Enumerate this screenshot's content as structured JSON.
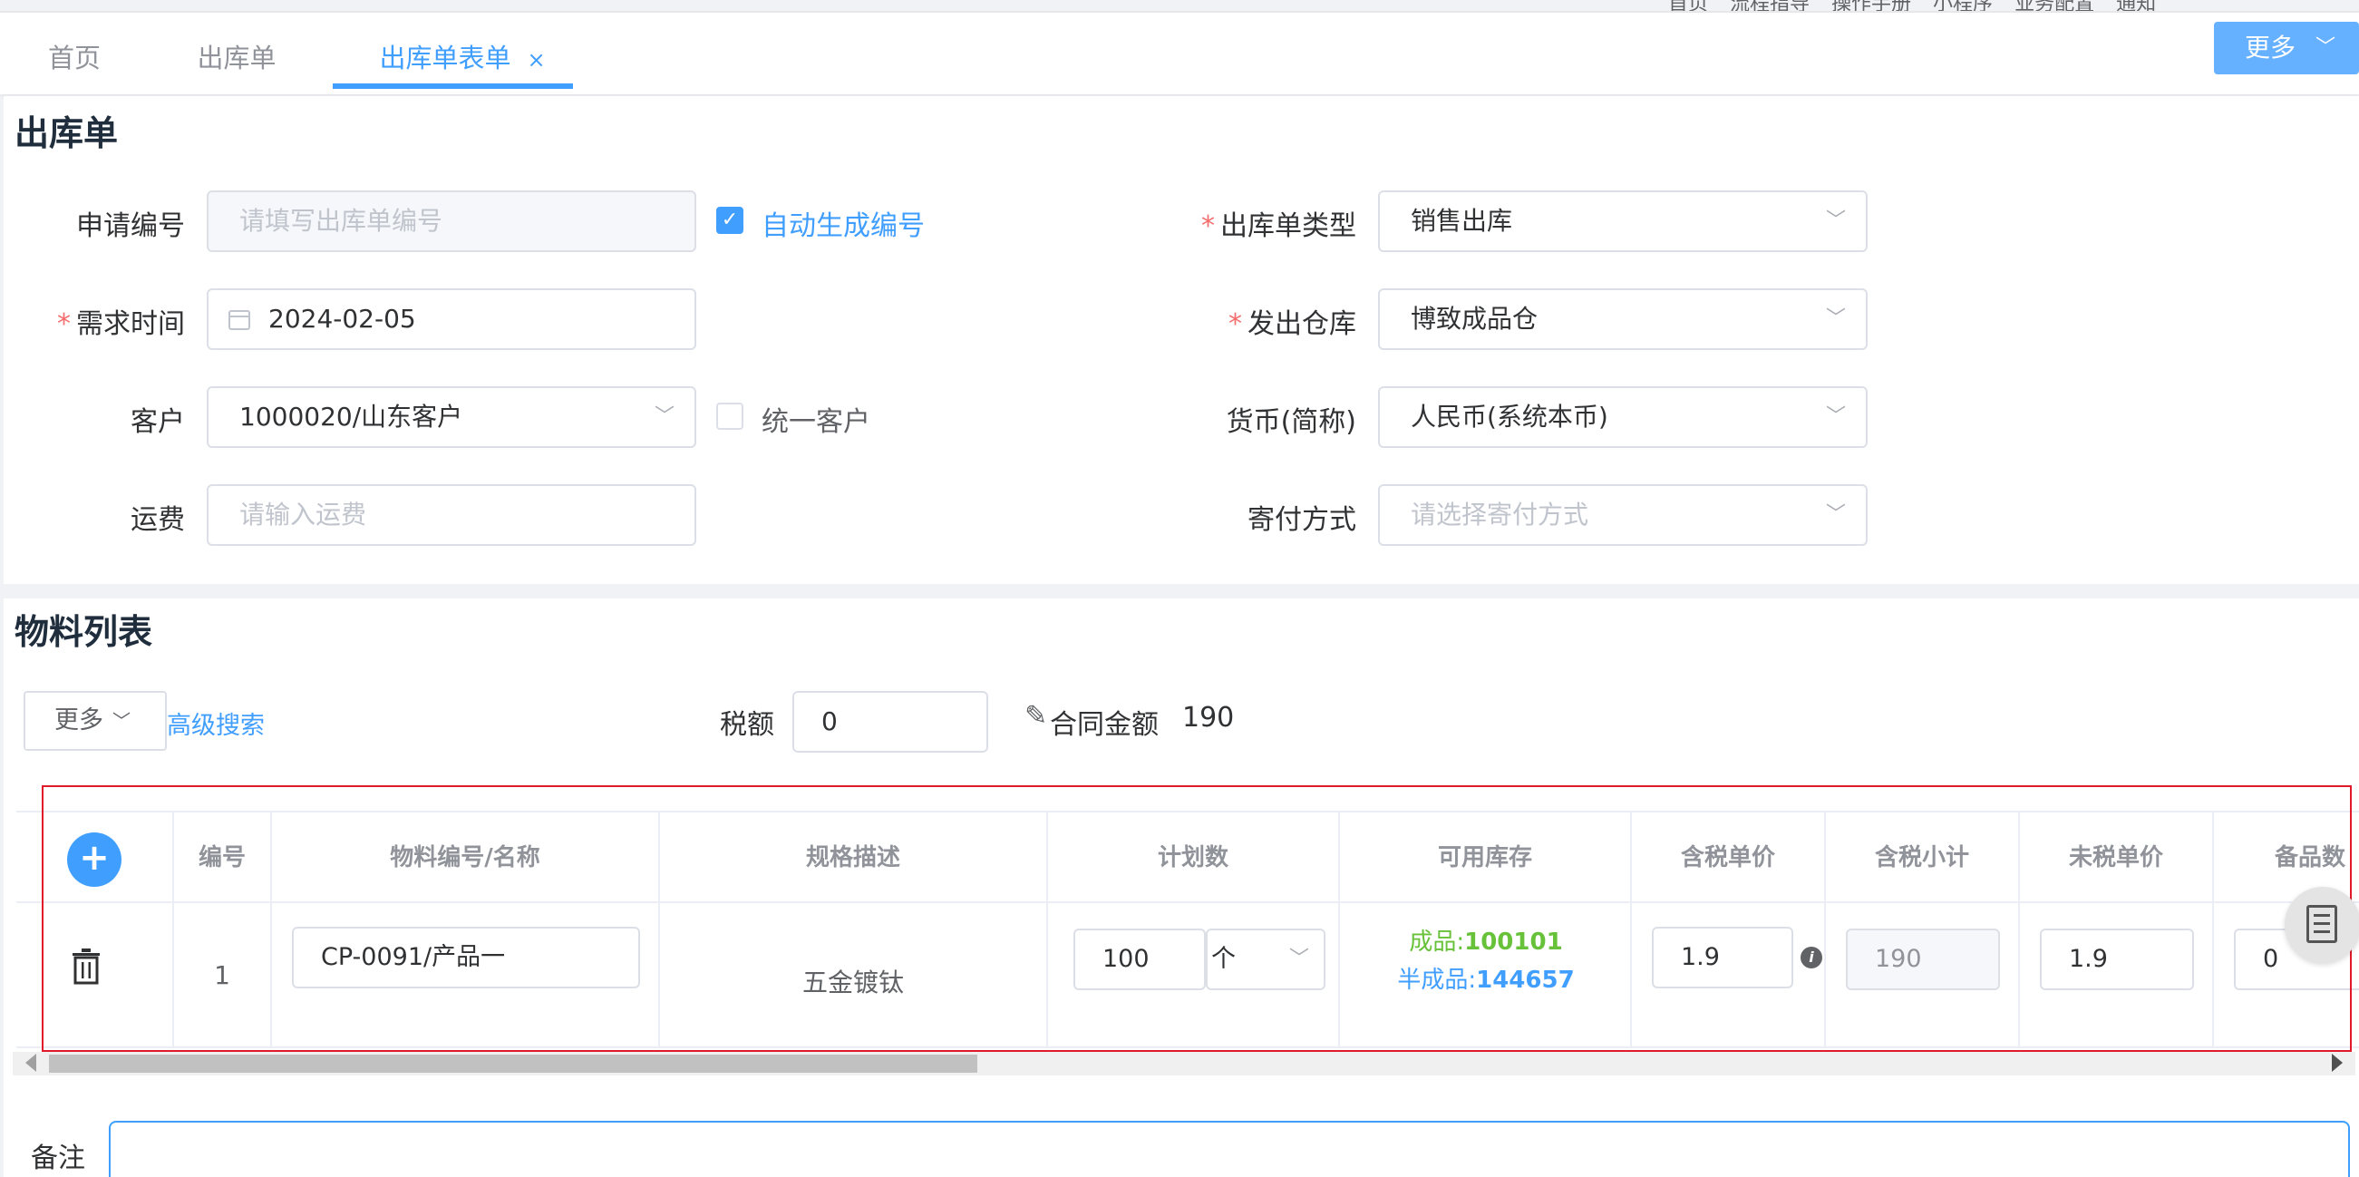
{
  "top_nav": {
    "links": [
      "首页",
      "流程指导",
      "操作手册",
      "小程序",
      "业务配置",
      "通知"
    ]
  },
  "tabs": [
    {
      "label": "首页",
      "active": false
    },
    {
      "label": "出库单",
      "active": false
    },
    {
      "label": "出库单表单",
      "active": true,
      "close": "×"
    }
  ],
  "more_button": {
    "label": "更多",
    "icon": "chevron-down-icon"
  },
  "form": {
    "title": "出库单",
    "apply_no": {
      "label": "申请编号",
      "placeholder": "请填写出库单编号"
    },
    "auto_number": {
      "label": "自动生成编号",
      "checked": true
    },
    "out_type": {
      "label": "出库单类型",
      "value": "销售出库",
      "required": true
    },
    "demand_time": {
      "label": "需求时间",
      "value": "2024-02-05",
      "required": true
    },
    "warehouse": {
      "label": "发出仓库",
      "value": "博致成品仓",
      "required": true
    },
    "customer": {
      "label": "客户",
      "value": "1000020/山东客户"
    },
    "unified_customer": {
      "label": "统一客户",
      "checked": false
    },
    "currency": {
      "label": "货币(简称)",
      "value": "人民币(系统本币)"
    },
    "freight": {
      "label": "运费",
      "placeholder": "请输入运费"
    },
    "shipping": {
      "label": "寄付方式",
      "placeholder": "请选择寄付方式"
    }
  },
  "materials": {
    "title": "物料列表",
    "more_label": "更多",
    "advanced_search": "高级搜索",
    "tax_label": "税额",
    "tax_value": "0",
    "contract_label": "合同金额",
    "contract_value": "190",
    "columns": [
      "编号",
      "物料编号/名称",
      "规格描述",
      "计划数",
      "可用库存",
      "含税单价",
      "含税小计",
      "未税单价",
      "备品数"
    ],
    "row": {
      "no": "1",
      "material": "CP-0091/产品一",
      "spec": "五金镀钛",
      "plan_qty": "100",
      "unit": "个",
      "stock_label_1": "成品:",
      "stock_value_1": "100101",
      "stock_label_2": "半成品:",
      "stock_value_2": "144657",
      "tax_price": "1.9",
      "tax_subtotal": "190",
      "untax_price": "1.9",
      "spare_qty": "0"
    }
  },
  "remark": {
    "label": "备注"
  },
  "colors": {
    "accent": "#409eff",
    "required": "#f56c6c",
    "stock_green": "#67c23a",
    "highlight_border": "#e01a2a"
  }
}
